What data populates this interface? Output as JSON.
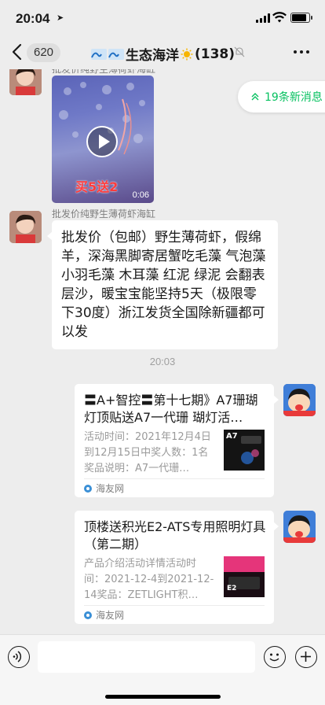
{
  "status": {
    "time": "20:04"
  },
  "nav": {
    "unread_count": "620",
    "title": "生态海洋",
    "member_count": "(138)"
  },
  "messages": {
    "video": {
      "sender_partial": "批发价纯野生薄荷虾海缸",
      "overlay_caption": "买5送2",
      "duration": "0:06"
    },
    "text": {
      "sender": "批发价纯野生薄荷虾海缸",
      "content": "批发价（包邮）野生薄荷虾，假绵羊，深海黑脚寄居蟹吃毛藻 气泡藻 小羽毛藻 木耳藻 红泥 绿泥 会翻表层沙，暖宝宝能坚持5天（极限零下30度）浙江发货全国除新疆都可以发"
    },
    "timestamp": "20:03",
    "cards": [
      {
        "title": "〓A+智控〓第十七期》A7珊瑚灯顶贴送A7一代珊 瑚灯活…",
        "desc": "活动时间：2021年12月4日到12月15日中奖人数：1名奖品说明：A7一代珊…",
        "thumb_text": "A7",
        "source": "海友网"
      },
      {
        "title": "顶楼送积光E2-ATS专用照明灯具（第二期）",
        "desc": "产品介绍活动详情活动时间：2021-12-4到2021-12-14奖品：ZETLIGHT积…",
        "thumb_text": "E2",
        "source": "海友网"
      }
    ]
  },
  "new_messages_pill": "19条新消息",
  "colors": {
    "accent": "#07c160",
    "background": "#ededed",
    "bubble": "#ffffff"
  },
  "icons": [
    "back-arrow-icon",
    "mute-bell-icon",
    "more-icon",
    "voice-icon",
    "emoji-icon",
    "plus-icon",
    "play-icon",
    "chevron-up-double-icon"
  ]
}
